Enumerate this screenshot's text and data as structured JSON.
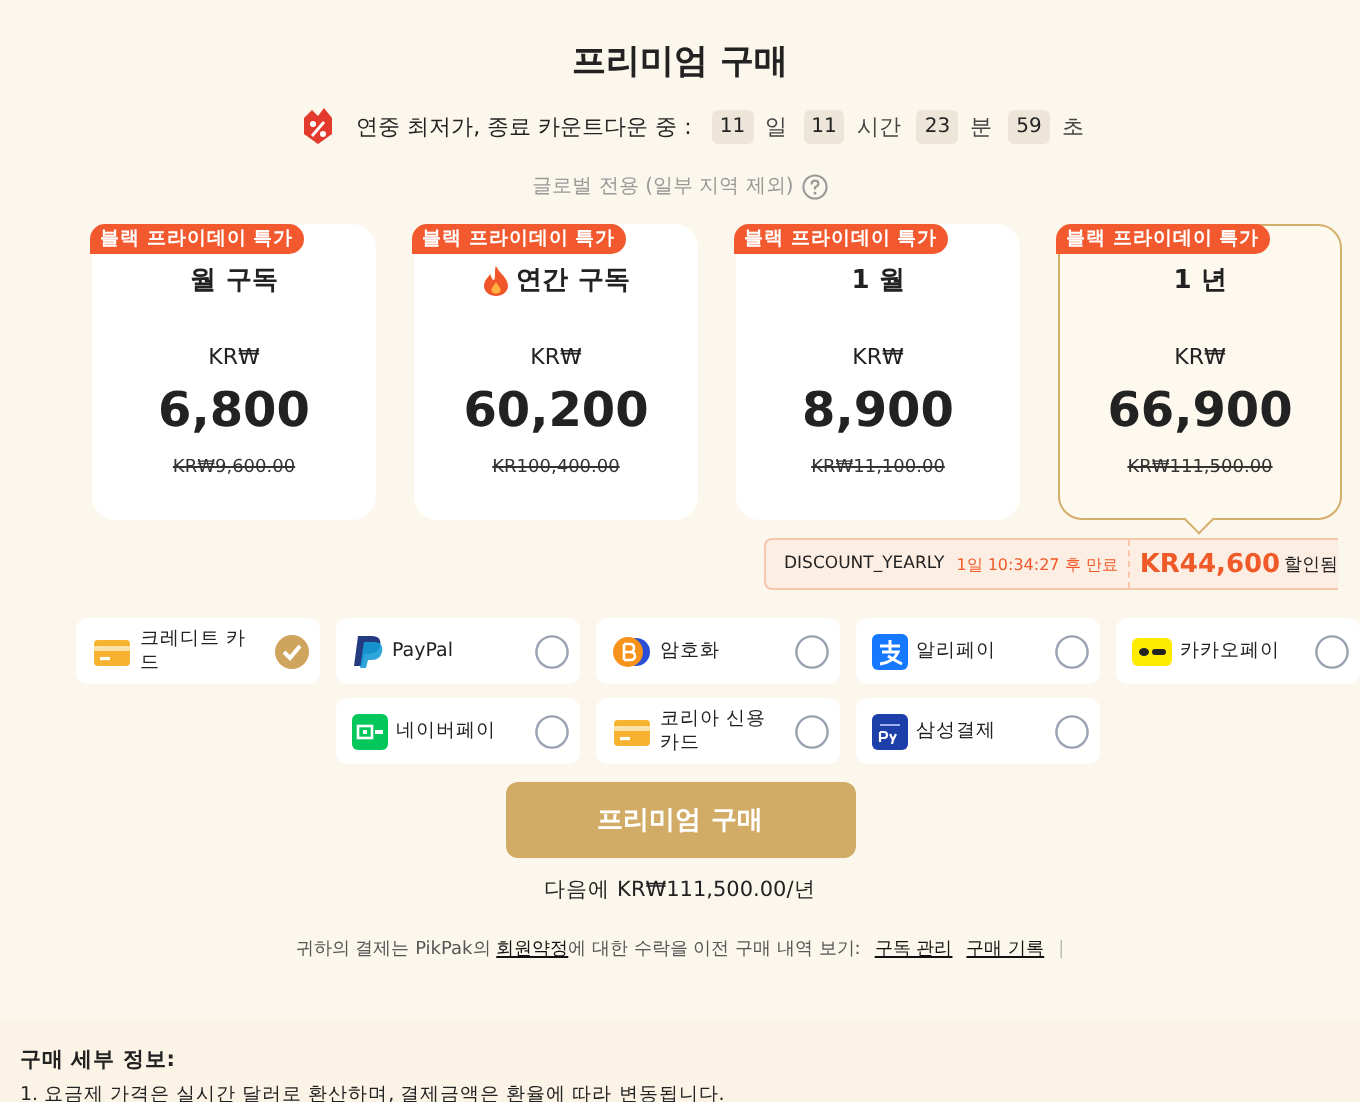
{
  "title": "프리미엄 구매",
  "countdown": {
    "label": "연중 최저가, 종료 카운트다운 중 :",
    "units": [
      {
        "value": "11",
        "unit": "일"
      },
      {
        "value": "11",
        "unit": "시간"
      },
      {
        "value": "23",
        "unit": "분"
      },
      {
        "value": "59",
        "unit": "초"
      }
    ]
  },
  "region_note": "글로벌 전용 (일부 지역 제외)",
  "plans": [
    {
      "badge": "블랙 프라이데이 특가",
      "name": "월 구독",
      "hot": false,
      "currency": "KR₩",
      "price": "6,800",
      "original": "KR₩9,600.00",
      "selected": false
    },
    {
      "badge": "블랙 프라이데이 특가",
      "name": "연간 구독",
      "hot": true,
      "currency": "KR₩",
      "price": "60,200",
      "original": "KR100,400.00",
      "selected": false
    },
    {
      "badge": "블랙 프라이데이 특가",
      "name": "1 월",
      "hot": false,
      "currency": "KR₩",
      "price": "8,900",
      "original": "KR₩11,100.00",
      "selected": false
    },
    {
      "badge": "블랙 프라이데이 특가",
      "name": "1 년",
      "hot": false,
      "currency": "KR₩",
      "price": "66,900",
      "original": "KR₩111,500.00",
      "selected": true
    }
  ],
  "discount": {
    "code": "DISCOUNT_YEARLY",
    "expiry": "1일 10:34:27 후 만료",
    "amount": "KR44,600",
    "suffix": "할인됨"
  },
  "payment_methods": [
    {
      "kind": "card",
      "label": "크레디트 카드",
      "selected": true
    },
    {
      "kind": "paypal",
      "label": "PayPal",
      "selected": false
    },
    {
      "kind": "crypto",
      "label": "암호화",
      "selected": false
    },
    {
      "kind": "alipay",
      "label": "알리페이",
      "selected": false
    },
    {
      "kind": "kakaopay",
      "label": "카카오페이",
      "selected": false
    },
    {
      "kind": "naverpay",
      "label": "네이버페이",
      "selected": false
    },
    {
      "kind": "card",
      "label": "코리아 신용카드",
      "selected": false
    },
    {
      "kind": "samsungpay",
      "label": "삼성결제",
      "selected": false
    }
  ],
  "buy_button": "프리미엄 구매",
  "next_charge": "다음에 KR₩111,500.00/년",
  "footer": {
    "before": "귀하의 결제는 PikPak의 ",
    "link": "회원약정",
    "after": "에 대한 수락을 이전 구매 내역 보기:",
    "links": [
      "구독 관리",
      "구매 기록"
    ],
    "separator": "|"
  },
  "details": {
    "title": "구매 세부 정보:",
    "items": [
      "1. 요금제 가격은 실시간 달러로 환산하며, 결제금액은 환율에 따라 변동됩니다."
    ]
  }
}
